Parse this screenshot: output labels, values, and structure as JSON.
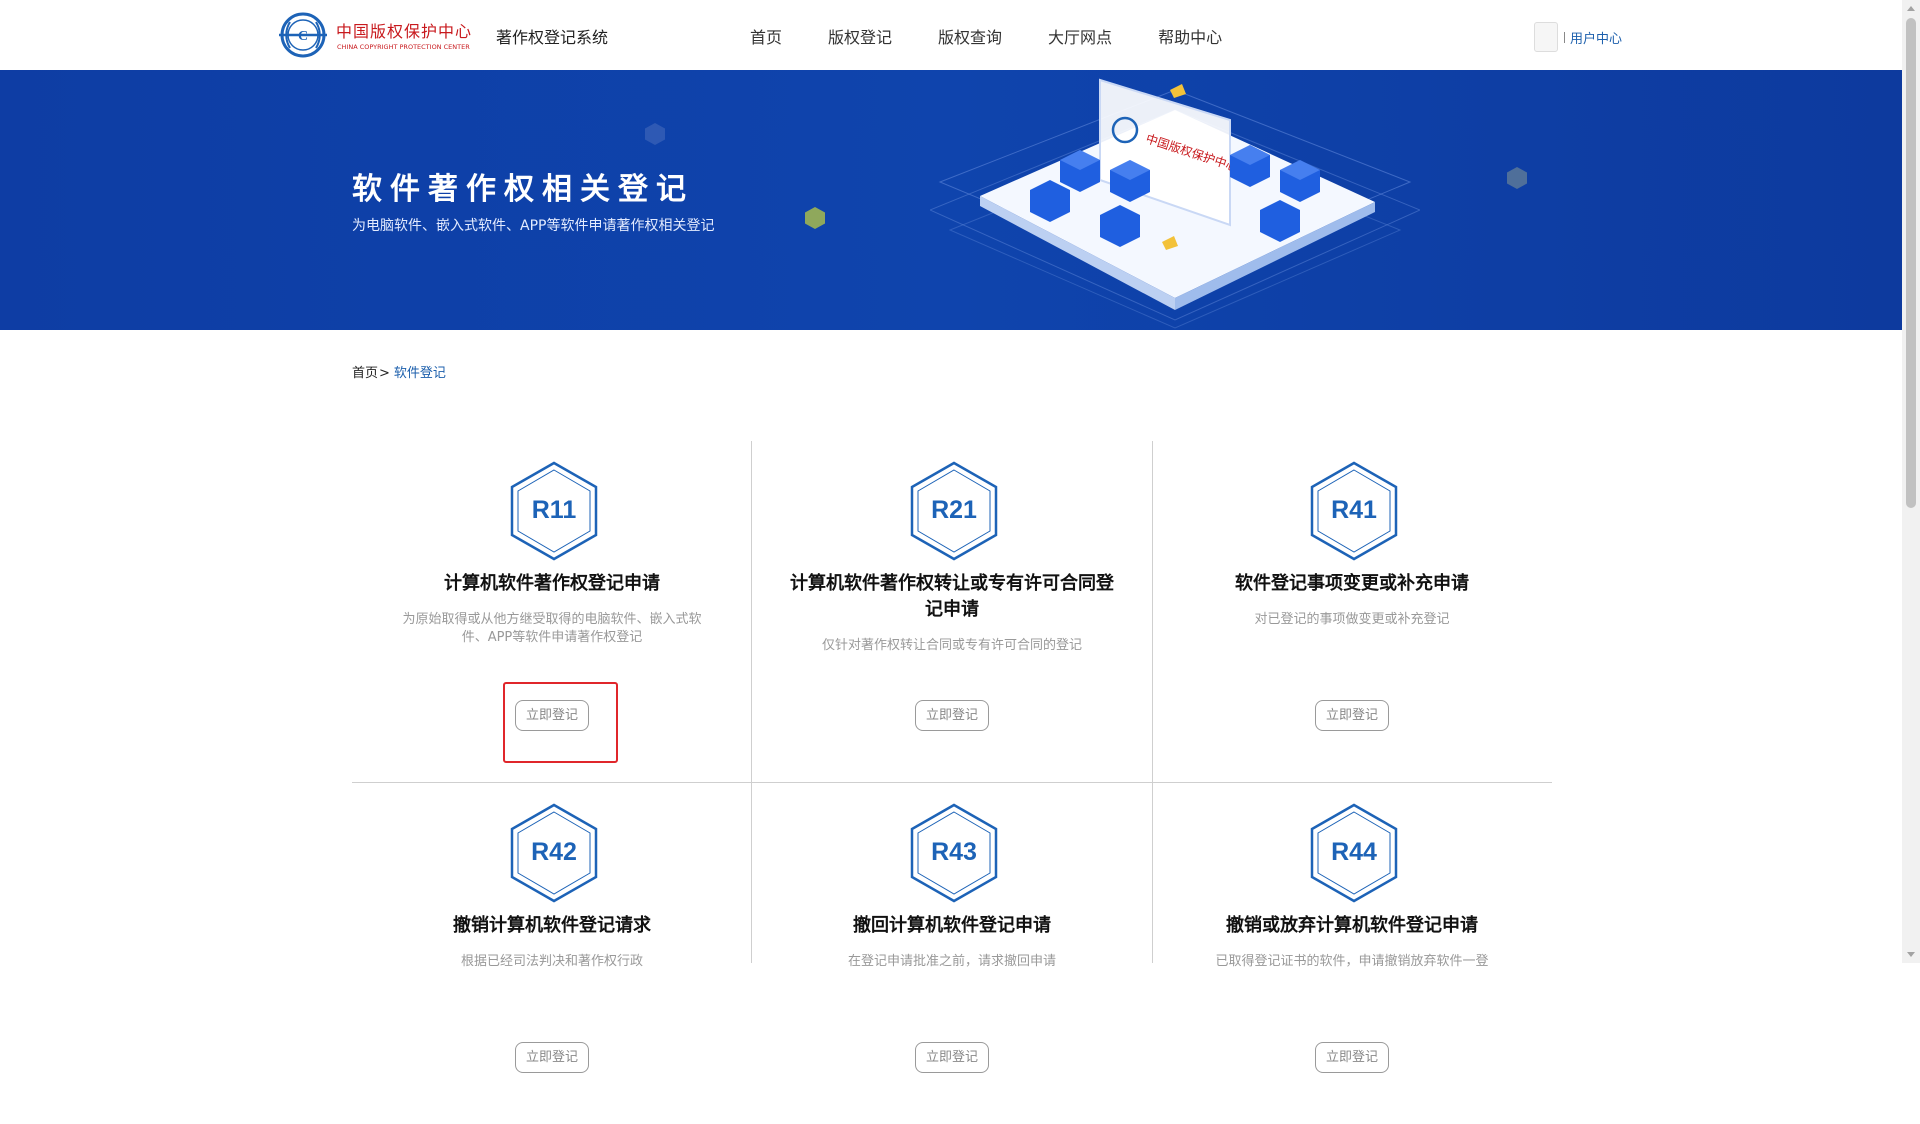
{
  "header": {
    "logo": {
      "cn": "中国版权保护中心",
      "en": "CHINA COPYRIGHT PROTECTION CENTER"
    },
    "system_name": "著作权登记系统",
    "nav": [
      "首页",
      "版权登记",
      "版权查询",
      "大厅网点",
      "帮助中心"
    ],
    "user_center": "用户中心"
  },
  "banner": {
    "title": "软件著作权相关登记",
    "subtitle": "为电脑软件、嵌入式软件、APP等软件申请著作权相关登记",
    "art_logo_text": "中国版权保护中心"
  },
  "breadcrumb": {
    "home": "首页",
    "separator": ">",
    "current": "软件登记"
  },
  "cards": [
    {
      "code": "R11",
      "title": "计算机软件著作权登记申请",
      "desc": "为原始取得或从他方继受取得的电脑软件、嵌入式软件、APP等软件申请著作权登记",
      "button": "立即登记"
    },
    {
      "code": "R21",
      "title": "计算机软件著作权转让或专有许可合同登记申请",
      "desc": "仅针对著作权转让合同或专有许可合同的登记",
      "button": "立即登记"
    },
    {
      "code": "R41",
      "title": "软件登记事项变更或补充申请",
      "desc": "对已登记的事项做变更或补充登记",
      "button": "立即登记"
    },
    {
      "code": "R42",
      "title": "撤销计算机软件登记请求",
      "desc": "根据已经司法判决和著作权行政",
      "button": "立即登记"
    },
    {
      "code": "R43",
      "title": "撤回计算机软件登记申请",
      "desc": "在登记申请批准之前，请求撤回申请",
      "button": "立即登记"
    },
    {
      "code": "R44",
      "title": "撤销或放弃计算机软件登记申请",
      "desc": "已取得登记证书的软件，申请撤销放弃软件一登",
      "button": "立即登记"
    }
  ],
  "colors": {
    "brand_blue": "#1d63b7",
    "banner_blue": "#0f44ad",
    "highlight_red": "#e0262b",
    "logo_red": "#c8191d"
  }
}
